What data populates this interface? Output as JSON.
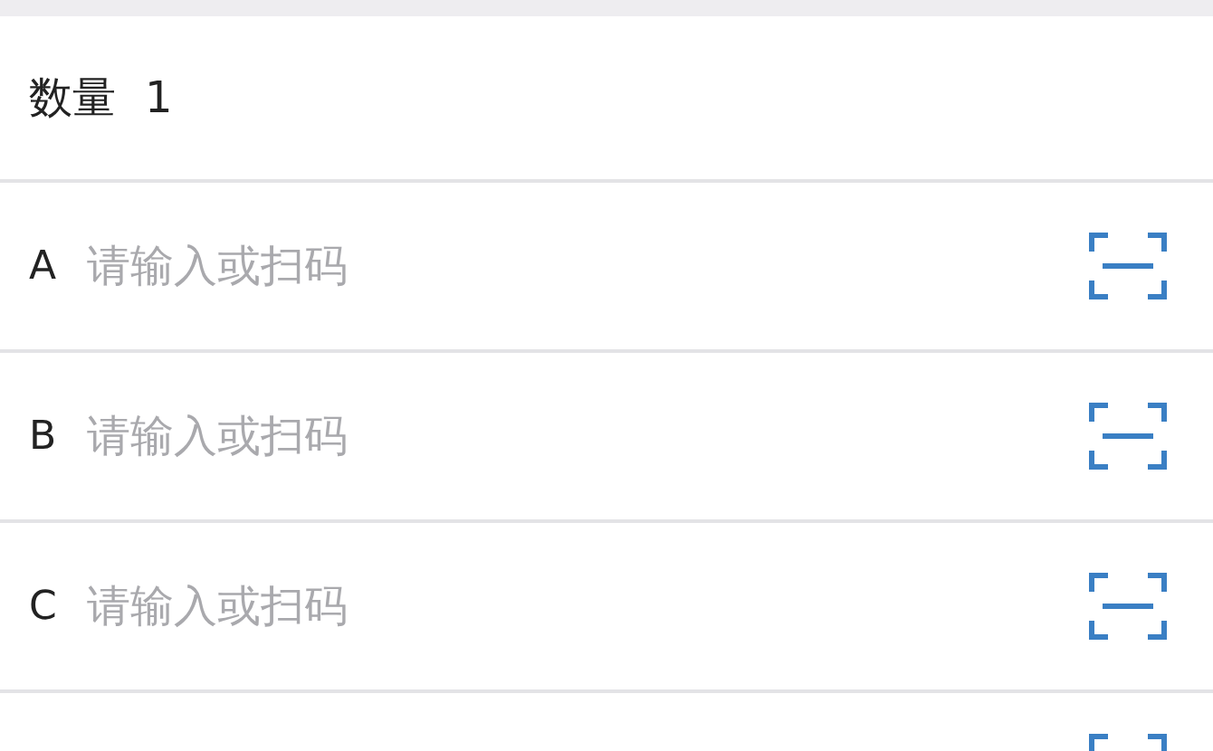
{
  "quantity": {
    "label": "数量",
    "value": "1"
  },
  "fields": [
    {
      "label": "A",
      "placeholder": "请输入或扫码"
    },
    {
      "label": "B",
      "placeholder": "请输入或扫码"
    },
    {
      "label": "C",
      "placeholder": "请输入或扫码"
    }
  ]
}
